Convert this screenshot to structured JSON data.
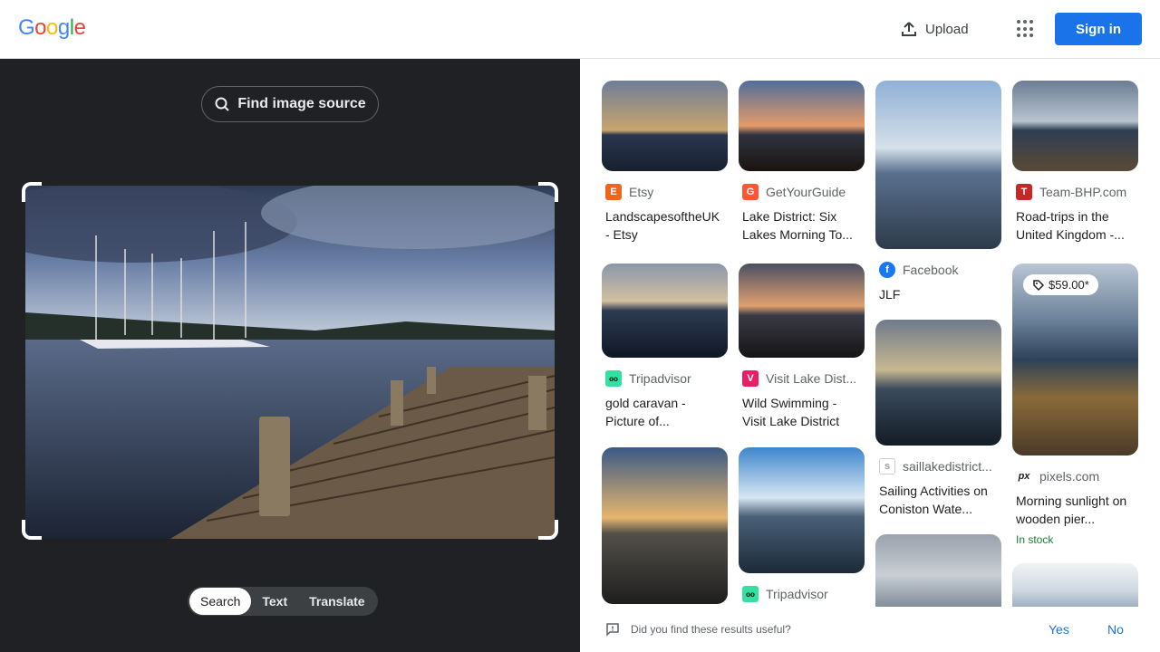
{
  "header": {
    "logo": "Google",
    "upload_label": "Upload",
    "apps_icon": "apps-grid-icon",
    "signin_label": "Sign in",
    "brand_color": "#1a73e8"
  },
  "lens": {
    "find_source_label": "Find image source",
    "modes": [
      "Search",
      "Text",
      "Translate"
    ],
    "active_mode": "Search"
  },
  "results": [
    {
      "source": "Etsy",
      "favicon": "E",
      "favicon_color": "#f1641e",
      "title": "LandscapesoftheUK - Etsy"
    },
    {
      "source": "GetYourGuide",
      "favicon": "G",
      "favicon_color": "#ff5533",
      "title": "Lake District: Six Lakes Morning To..."
    },
    {
      "source": "Facebook",
      "favicon": "f",
      "favicon_color": "#1877f2",
      "title": "JLF"
    },
    {
      "source": "Team-BHP.com",
      "favicon": "T",
      "favicon_color": "#c62828",
      "title": "Road-trips in the United Kingdom -..."
    },
    {
      "source": "Tripadvisor",
      "favicon": "oo",
      "favicon_color": "#34e0a1",
      "title": "gold caravan - Picture of..."
    },
    {
      "source": "Visit Lake Dist...",
      "favicon": "V",
      "favicon_color": "#e91e63",
      "title": "Wild Swimming - Visit Lake District"
    },
    {
      "source": "saillakedistrict...",
      "favicon": "s",
      "favicon_color": "#9e9e9e",
      "title": "Sailing Activities on Coniston Wate..."
    },
    {
      "source": "pixels.com",
      "favicon": "px",
      "favicon_color": "#202124",
      "title": "Morning sunlight on wooden pier...",
      "price": "$59.00*",
      "stock": "In stock"
    },
    {
      "source": "Tripadvisor",
      "favicon": "oo",
      "favicon_color": "#34e0a1",
      "title": ""
    }
  ],
  "feedback": {
    "question": "Did you find these results useful?",
    "yes": "Yes",
    "no": "No"
  }
}
